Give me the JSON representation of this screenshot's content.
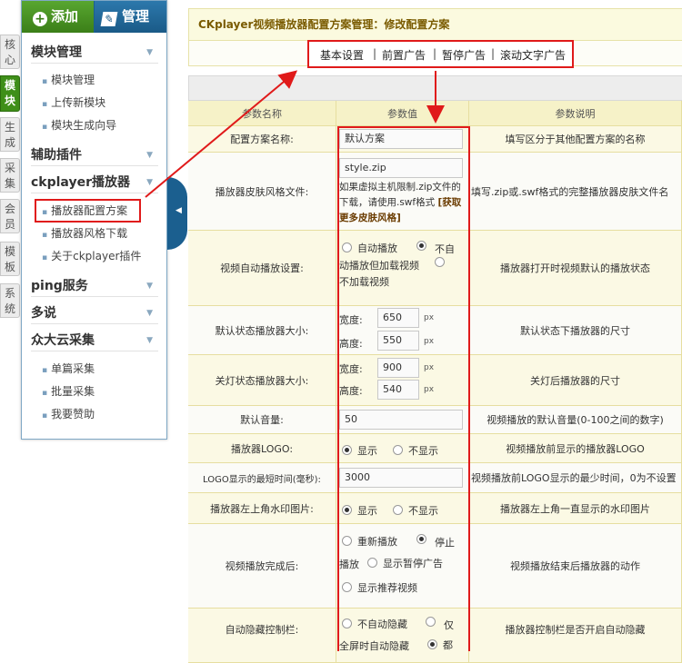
{
  "left_tabs": [
    {
      "label": "核心",
      "active": false
    },
    {
      "label": "模块",
      "active": true
    },
    {
      "label": "生成",
      "active": false
    },
    {
      "label": "采集",
      "active": false
    },
    {
      "label": "会员",
      "active": false
    },
    {
      "label": "模板",
      "active": false
    },
    {
      "label": "系统",
      "active": false
    }
  ],
  "top_buttons": {
    "add": "添加",
    "manage": "管理"
  },
  "sidebar": {
    "module_mgmt": {
      "title": "模块管理",
      "items": [
        "模块管理",
        "上传新模块",
        "模块生成向导"
      ]
    },
    "aux_plugins": {
      "title": "辅助插件"
    },
    "ckplayer": {
      "title": "ckplayer播放器",
      "items": [
        "播放器配置方案",
        "播放器风格下载",
        "关于ckplayer插件"
      ]
    },
    "ping": {
      "title": "ping服务"
    },
    "duoshuo": {
      "title": "多说"
    },
    "cloud": {
      "title": "众大云采集",
      "items": [
        "单篇采集",
        "批量采集",
        "我要赞助"
      ]
    }
  },
  "main": {
    "title": "CKplayer视频播放器配置方案管理：修改配置方案",
    "tabs": [
      "基本设置",
      "前置广告",
      "暂停广告",
      "滚动文字广告"
    ],
    "headers": [
      "参数名称",
      "参数值",
      "参数说明"
    ]
  },
  "rows": {
    "name": {
      "label": "配置方案名称:",
      "value": "默认方案",
      "desc": "填写区分于其他配置方案的名称"
    },
    "skin": {
      "label": "播放器皮肤风格文件:",
      "value": "style.zip",
      "help": "如果虚拟主机限制.zip文件的下载，请使用.swf格式",
      "link": "[获取更多皮肤风格]",
      "desc": "填写.zip或.swf格式的完整播放器皮肤文件名"
    },
    "autoplay": {
      "label": "视频自动播放设置:",
      "options": [
        "自动播放",
        "不自动播放但加载视频",
        "不加载视频"
      ],
      "selected": 1,
      "desc": "播放器打开时视频默认的播放状态"
    },
    "default_size": {
      "label": "默认状态播放器大小:",
      "width_label": "宽度:",
      "height_label": "高度:",
      "width": "650",
      "height": "550",
      "unit": "px",
      "desc": "默认状态下播放器的尺寸"
    },
    "light_off_size": {
      "label": "关灯状态播放器大小:",
      "width_label": "宽度:",
      "height_label": "高度:",
      "width": "900",
      "height": "540",
      "unit": "px",
      "desc": "关灯后播放器的尺寸"
    },
    "volume": {
      "label": "默认音量:",
      "value": "50",
      "desc": "视频播放的默认音量(0-100之间的数字)"
    },
    "logo": {
      "label": "播放器LOGO:",
      "options": [
        "显示",
        "不显示"
      ],
      "selected": 0,
      "desc": "视频播放前显示的播放器LOGO"
    },
    "logo_time": {
      "label": "LOGO显示的最短时间(毫秒):",
      "value": "3000",
      "desc": "视频播放前LOGO显示的最少时间，0为不设置"
    },
    "watermark": {
      "label": "播放器左上角水印图片:",
      "options": [
        "显示",
        "不显示"
      ],
      "selected": 0,
      "desc": "播放器左上角一直显示的水印图片"
    },
    "after_play": {
      "label": "视频播放完成后:",
      "options": [
        "重新播放",
        "停止播放",
        "显示暂停广告",
        "显示推荐视频"
      ],
      "selected": 1,
      "desc": "视频播放结束后播放器的动作"
    },
    "auto_hide": {
      "label": "自动隐藏控制栏:",
      "options": [
        "不自动隐藏",
        "仅全屏时自动隐藏",
        "都"
      ],
      "desc": "播放器控制栏是否开启自动隐藏"
    }
  },
  "colors": {
    "accent_green": "#3f8f19",
    "nav_blue": "#1b5f8f",
    "highlight_red": "#e01a1a"
  }
}
